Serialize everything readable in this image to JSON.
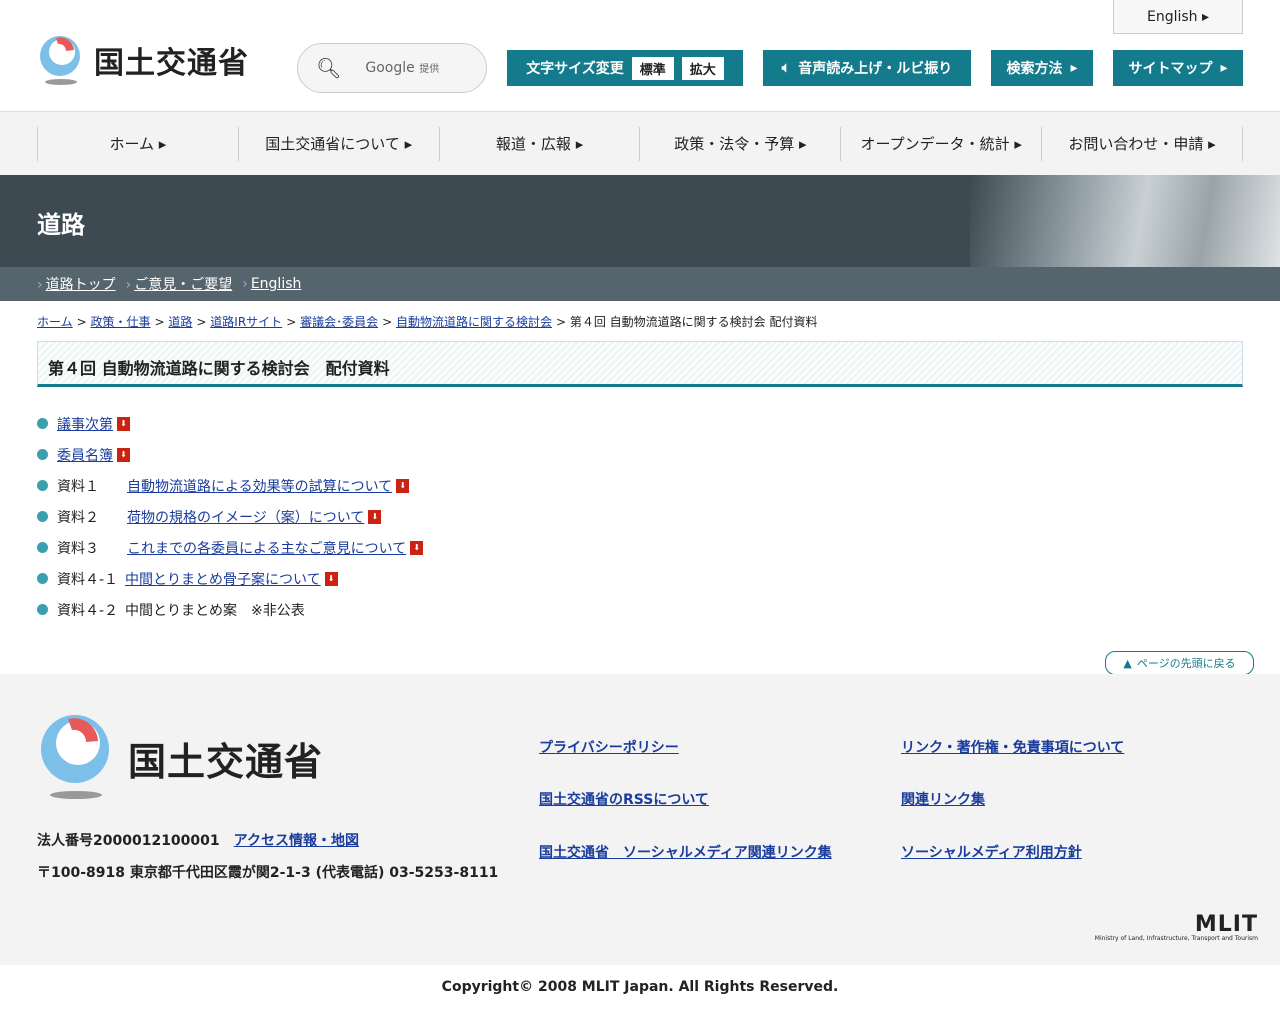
{
  "header": {
    "logo": "国土交通省",
    "search_brand": "Google",
    "search_note": "提供",
    "english": "English",
    "font_size_label": "文字サイズ変更",
    "font_std": "標準",
    "font_large": "拡大",
    "speech": "音声読み上げ・ルビ振り",
    "search_method": "検索方法",
    "sitemap": "サイトマップ"
  },
  "gnav": [
    "ホーム",
    "国土交通省について",
    "報道・広報",
    "政策・法令・予算",
    "オープンデータ・統計",
    "お問い合わせ・申請"
  ],
  "banner": {
    "title": "道路"
  },
  "subnav": [
    "道路トップ",
    "ご意見・ご要望",
    "English"
  ],
  "breadcrumb": {
    "links": [
      "ホーム",
      "政策・仕事",
      "道路",
      "道路IRサイト",
      "審議会･委員会",
      "自動物流道路に関する検討会"
    ],
    "current": "第４回 自動物流道路に関する検討会 配付資料"
  },
  "page_title": "第４回 自動物流道路に関する検討会　配付資料",
  "documents": [
    {
      "label": "",
      "title": "議事次第",
      "link": true
    },
    {
      "label": "",
      "title": "委員名簿",
      "link": true
    },
    {
      "label": "資料１",
      "title": "自動物流道路による効果等の試算について",
      "link": true
    },
    {
      "label": "資料２",
      "title": "荷物の規格のイメージ（案）について",
      "link": true
    },
    {
      "label": "資料３",
      "title": "これまでの各委員による主なご意見について",
      "link": true
    },
    {
      "label": "資料４-１",
      "title": "中間とりまとめ骨子案について",
      "link": true
    },
    {
      "label": "資料４-２",
      "title": "中間とりまとめ案　※非公表",
      "link": false
    }
  ],
  "back_to_top": "ページの先頭に戻る",
  "footer": {
    "logo": "国土交通省",
    "corp_no": "法人番号2000012100001",
    "access": "アクセス情報・地図",
    "address": "〒100-8918 東京都千代田区霞が関2-1-3 (代表電話) 03-5253-8111",
    "links": [
      "プライバシーポリシー",
      "リンク・著作権・免責事項について",
      "国土交通省のRSSについて",
      "関連リンク集",
      "国土交通省　ソーシャルメディア関連リンク集",
      "ソーシャルメディア利用方針"
    ],
    "mlit": "MLIT",
    "mlit_sub": "Ministry of Land, Infrastructure, Transport and Tourism",
    "copyright": "Copyright© 2008 MLIT Japan. All Rights Reserved."
  }
}
